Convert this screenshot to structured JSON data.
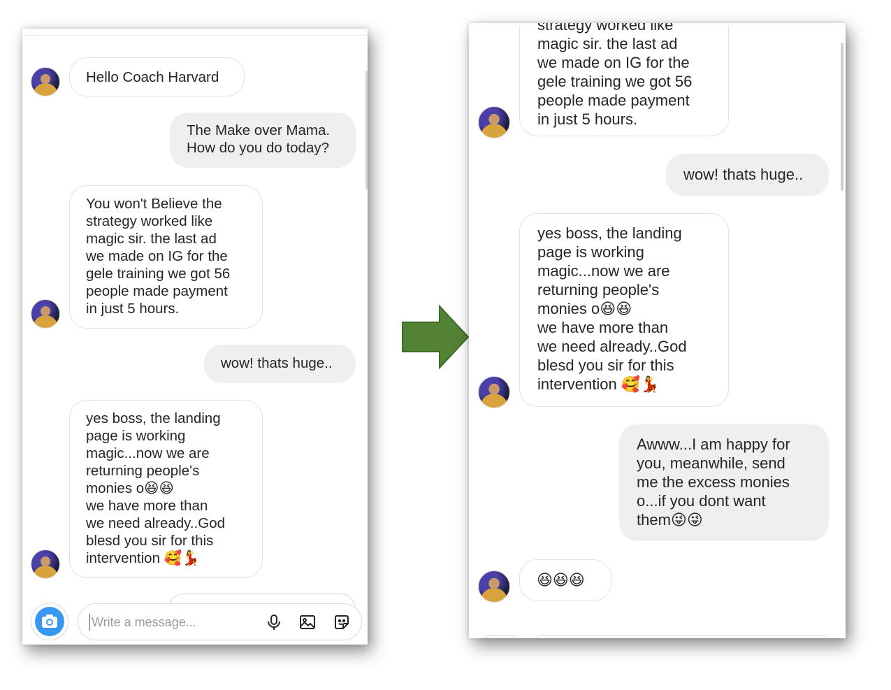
{
  "left": {
    "messages": [
      {
        "side": "in",
        "text": "Hello Coach Harvard"
      },
      {
        "side": "out",
        "text": "The Make over Mama.\nHow do you do today?"
      },
      {
        "side": "in",
        "text": "You won't  Believe the\nstrategy worked like\nmagic sir. the last ad\nwe made on IG for the\ngele training we got 56\npeople made payment\nin just 5 hours."
      },
      {
        "side": "out",
        "text": "wow! thats huge.."
      },
      {
        "side": "in",
        "text": "yes boss, the landing\npage is working\nmagic...now we are\nreturning people's\nmonies o😆😆\nwe have more than\nwe need already..God\nblesd you sir for this\nintervention 🥰💃"
      }
    ],
    "composer": {
      "placeholder": "Write a message..."
    }
  },
  "right": {
    "messages": [
      {
        "side": "in",
        "text": "strategy worked like\nmagic sir. the last ad\nwe made on IG for the\ngele training we got 56\npeople made payment\nin just 5 hours."
      },
      {
        "side": "out",
        "text": "wow! thats huge.."
      },
      {
        "side": "in",
        "text": "yes boss, the landing\npage is working\nmagic...now we are\nreturning people's\nmonies o😆😆\nwe have more than\nwe need already..God\nblesd you sir for this\nintervention 🥰💃"
      },
      {
        "side": "out",
        "text": "Awww...I am happy for\nyou, meanwhile, send\nme the excess monies\no...if you dont want\nthem😜😜"
      },
      {
        "side": "in",
        "text": "😆😆😆"
      }
    ]
  },
  "icons": {
    "camera": "camera-icon",
    "mic": "microphone-icon",
    "gallery": "image-icon",
    "sticker": "sticker-icon",
    "arrow": "right-arrow"
  },
  "colors": {
    "accent": "#3897f0",
    "outgoing_bubble": "#efefef",
    "arrow_fill": "#548235",
    "arrow_stroke": "#3e6a29"
  }
}
